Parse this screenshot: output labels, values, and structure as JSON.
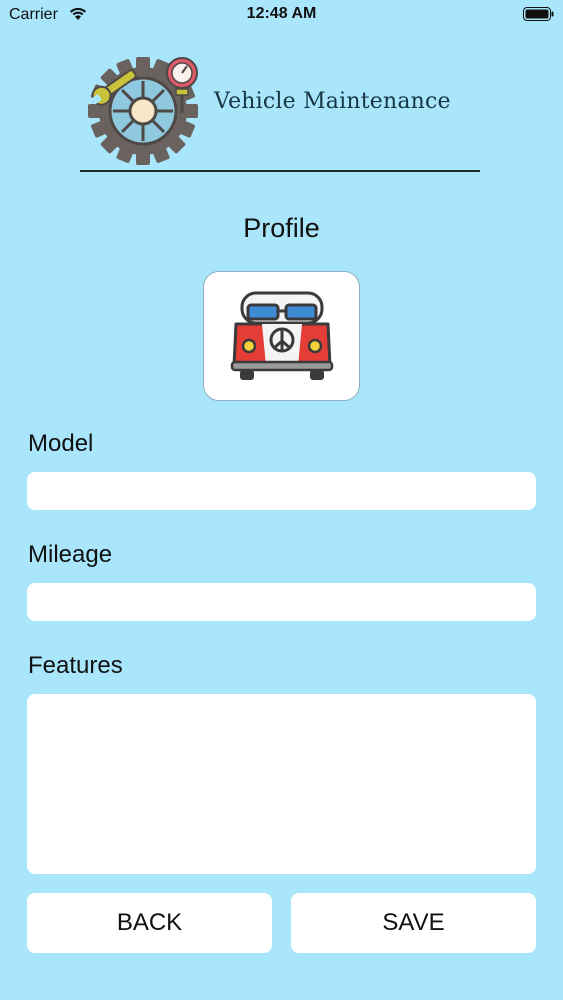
{
  "status_bar": {
    "carrier": "Carrier",
    "time": "12:48 AM",
    "wifi_icon": "wifi-icon",
    "battery_icon": "battery-icon"
  },
  "header": {
    "app_title": "Vehicle Maintenance",
    "logo_icon": "gear-wrench-gauge-icon"
  },
  "page_title": "Profile",
  "vehicle_image_icon": "van-icon",
  "form": {
    "model": {
      "label": "Model",
      "value": "",
      "placeholder": ""
    },
    "mileage": {
      "label": "Mileage",
      "value": "",
      "placeholder": ""
    },
    "features": {
      "label": "Features",
      "value": "",
      "placeholder": ""
    }
  },
  "buttons": {
    "back": "BACK",
    "save": "SAVE"
  },
  "colors": {
    "background": "#a9e6fb",
    "field_background": "#ffffff",
    "title_text": "#173746"
  }
}
